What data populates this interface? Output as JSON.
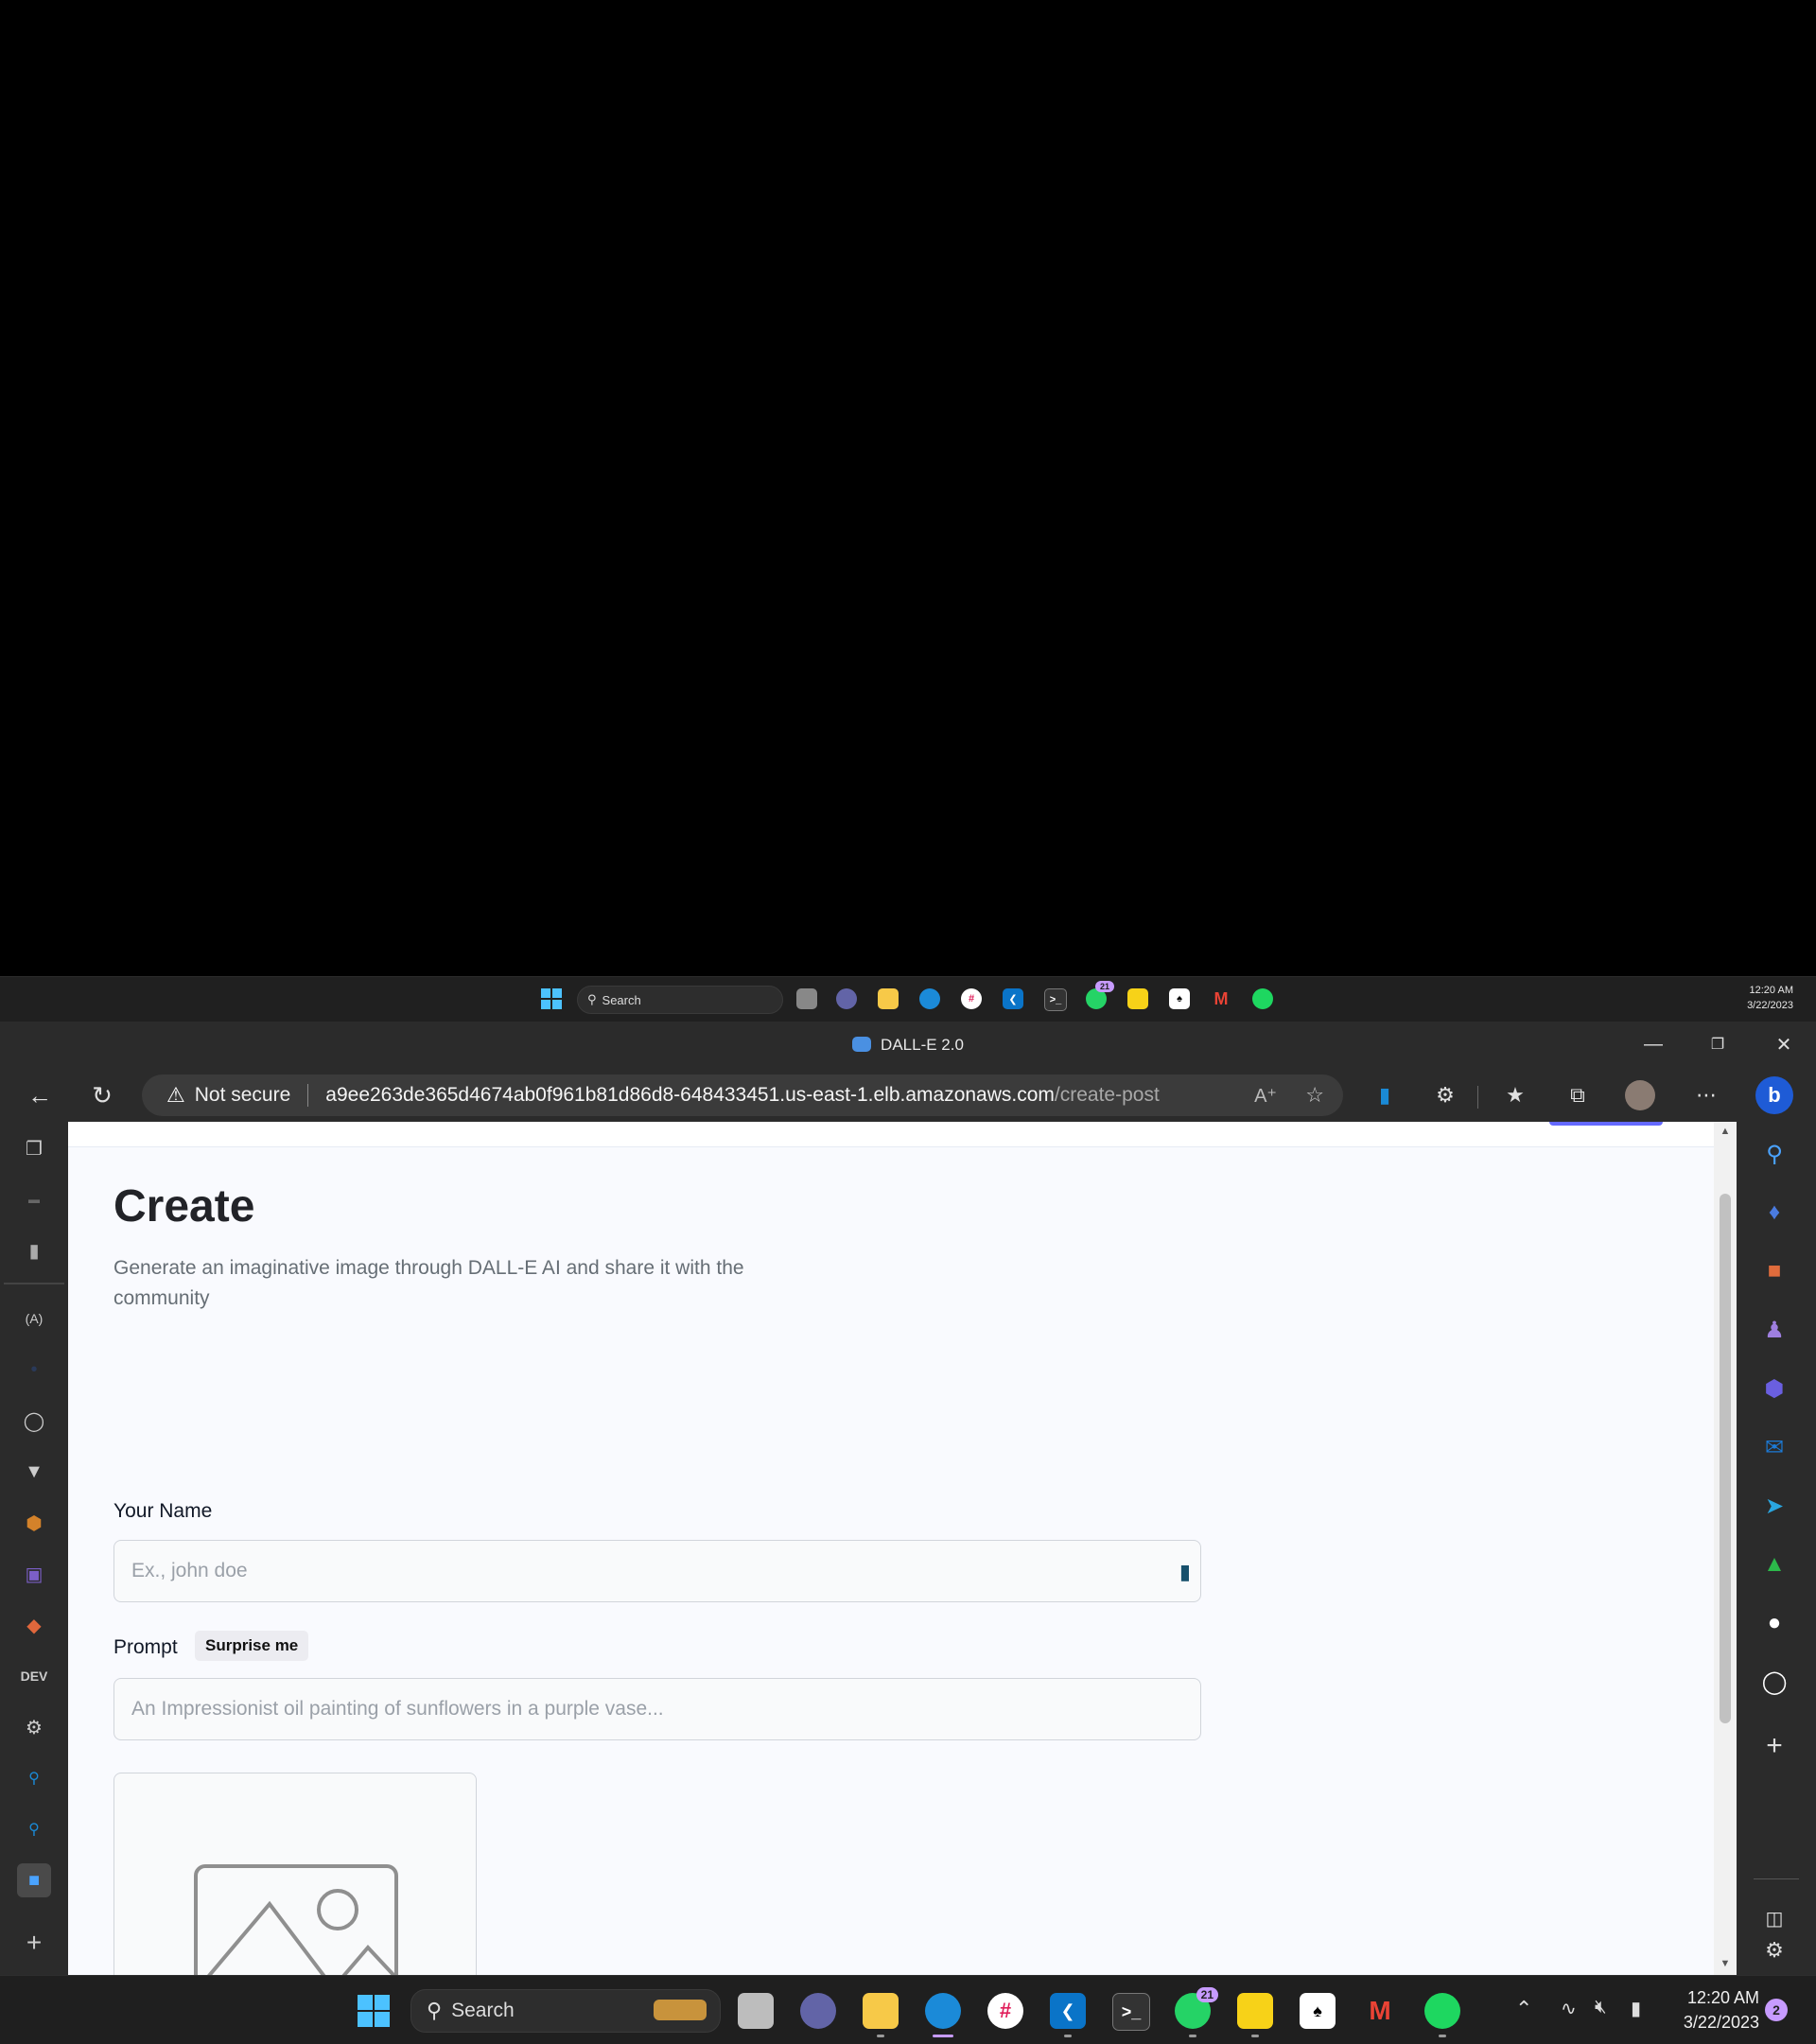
{
  "secondary_taskbar": {
    "search_label": "Search",
    "whatsapp_badge": "21",
    "time": "12:20 AM",
    "date": "3/22/2023"
  },
  "browser": {
    "tab_title": "DALL-E 2.0",
    "security_label": "Not secure",
    "url_host": "a9ee263de365d4674ab0f961b81d86d8-648433451.us-east-1.elb.amazonaws.com",
    "url_path": "/create-post"
  },
  "left_sidebar": {
    "dev_label": "DEV"
  },
  "page": {
    "title": "Create",
    "subtitle": "Generate an imaginative image through DALL-E AI and share it with the community",
    "name_label": "Your Name",
    "name_placeholder": "Ex., john doe",
    "prompt_label": "Prompt",
    "surprise_button": "Surprise me",
    "prompt_placeholder": "An Impressionist oil painting of sunflowers in a purple vase..."
  },
  "taskbar": {
    "search_label": "Search",
    "whatsapp_badge": "21",
    "time": "12:20 AM",
    "date": "3/22/2023",
    "notification_count": "2"
  },
  "colors": {
    "page_bg": "#f9fafe",
    "chrome_bg": "#2b2b2b",
    "taskbar_bg": "#1f1f1f",
    "accent_blue": "#0078d4",
    "title_text": "#222328",
    "subtitle_text": "#666e75"
  }
}
